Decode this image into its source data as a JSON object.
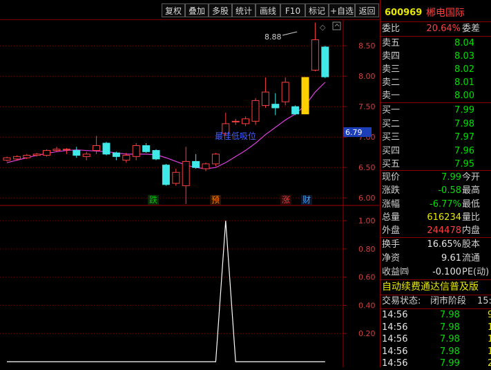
{
  "toolbar": {
    "buttons": [
      "复权",
      "叠加",
      "多股",
      "统计",
      "画线",
      "F10",
      "标记",
      "+自选",
      "返回"
    ]
  },
  "stock": {
    "code": "600969",
    "name": "郴电国际"
  },
  "orderbook": {
    "webi_label": "委比",
    "webi_value": "20.64%",
    "weicha_label": "委差",
    "asks": [
      {
        "label": "卖五",
        "price": "8.04"
      },
      {
        "label": "卖四",
        "price": "8.03"
      },
      {
        "label": "卖三",
        "price": "8.02"
      },
      {
        "label": "卖二",
        "price": "8.01"
      },
      {
        "label": "卖一",
        "price": "8.00"
      }
    ],
    "bids": [
      {
        "label": "买一",
        "price": "7.99"
      },
      {
        "label": "买二",
        "price": "7.98"
      },
      {
        "label": "买三",
        "price": "7.97"
      },
      {
        "label": "买四",
        "price": "7.96"
      },
      {
        "label": "买五",
        "price": "7.95"
      }
    ]
  },
  "quote": {
    "rows": [
      {
        "label": "现价",
        "value": "7.99",
        "label2": "今开"
      },
      {
        "label": "涨跌",
        "value": "-0.58",
        "label2": "最高"
      },
      {
        "label": "涨幅",
        "value": "-6.77%",
        "label2": "最低"
      },
      {
        "label": "总量",
        "value": "616234",
        "label2": "量比"
      },
      {
        "label": "外盘",
        "value": "244478",
        "label2": "内盘"
      }
    ],
    "rows2": [
      {
        "label": "换手",
        "value": "16.65%",
        "label2": "股本"
      },
      {
        "label": "净资",
        "value": "9.61",
        "label2": "流通"
      },
      {
        "label": "收益㈣",
        "value": "-0.100",
        "label2": "PE(动)"
      }
    ]
  },
  "news_ticker": "自动续费通达信普及版",
  "trade_status": {
    "label": "交易状态:",
    "value": "闭市阶段",
    "time": "15:"
  },
  "ticks": [
    {
      "time": "14:56",
      "price": "7.98",
      "vol": "9"
    },
    {
      "time": "14:56",
      "price": "7.98",
      "vol": "1"
    },
    {
      "time": "14:56",
      "price": "7.98",
      "vol": "1"
    },
    {
      "time": "14:56",
      "price": "7.98",
      "vol": "1"
    },
    {
      "time": "14:56",
      "price": "7.99",
      "vol": "2"
    }
  ],
  "main_chart": {
    "y_ticks": [
      "8.50",
      "8.00",
      "7.50",
      "7.00",
      "6.50",
      "6.00"
    ],
    "y_values": [
      8.5,
      8.0,
      7.5,
      7.0,
      6.5,
      6.0
    ],
    "current_price_tag": "6.79",
    "high_label": "8.88",
    "annotation": "最佳低吸位",
    "signals": [
      {
        "text": "跌",
        "color": "#00c000"
      },
      {
        "text": "预",
        "color": "#ff8000"
      },
      {
        "text": "涨",
        "color": "#ff3030"
      },
      {
        "text": "财",
        "color": "#3fa0ff"
      }
    ]
  },
  "indicator_chart": {
    "y_ticks": [
      "1.00",
      "0.80",
      "0.60",
      "0.40",
      "0.20"
    ]
  },
  "chart_data": {
    "type": "candlestick",
    "ylim": [
      5.9,
      8.9
    ],
    "candles": [
      {
        "o": 6.62,
        "c": 6.66,
        "h": 6.68,
        "l": 6.6
      },
      {
        "o": 6.64,
        "c": 6.68,
        "h": 6.7,
        "l": 6.62
      },
      {
        "o": 6.66,
        "c": 6.7,
        "h": 6.72,
        "l": 6.64
      },
      {
        "o": 6.7,
        "c": 6.72,
        "h": 6.74,
        "l": 6.68
      },
      {
        "o": 6.7,
        "c": 6.78,
        "h": 6.8,
        "l": 6.68
      },
      {
        "o": 6.78,
        "c": 6.8,
        "h": 6.84,
        "l": 6.76
      },
      {
        "o": 6.8,
        "c": 6.8,
        "h": 6.82,
        "l": 6.72
      },
      {
        "o": 6.78,
        "c": 6.7,
        "h": 6.84,
        "l": 6.66
      },
      {
        "o": 6.68,
        "c": 6.72,
        "h": 6.76,
        "l": 6.62
      },
      {
        "o": 6.78,
        "c": 6.86,
        "h": 7.02,
        "l": 6.72
      },
      {
        "o": 6.9,
        "c": 6.72,
        "h": 6.92,
        "l": 6.7
      },
      {
        "o": 6.74,
        "c": 6.68,
        "h": 6.76,
        "l": 6.62
      },
      {
        "o": 6.62,
        "c": 6.7,
        "h": 6.74,
        "l": 6.58
      },
      {
        "o": 6.68,
        "c": 6.86,
        "h": 6.9,
        "l": 6.62
      },
      {
        "o": 6.86,
        "c": 6.76,
        "h": 6.9,
        "l": 6.74
      },
      {
        "o": 6.78,
        "c": 6.64,
        "h": 6.8,
        "l": 6.62
      },
      {
        "o": 6.54,
        "c": 6.22,
        "h": 6.56,
        "l": 6.2
      },
      {
        "o": 6.24,
        "c": 6.42,
        "h": 6.48,
        "l": 6.2
      },
      {
        "o": 6.2,
        "c": 6.6,
        "h": 6.84,
        "l": 5.9
      },
      {
        "o": 6.6,
        "c": 6.5,
        "h": 6.72,
        "l": 6.48
      },
      {
        "o": 6.48,
        "c": 6.56,
        "h": 6.58,
        "l": 6.44
      },
      {
        "o": 6.56,
        "c": 6.72,
        "h": 6.74,
        "l": 6.52
      },
      {
        "o": 7.06,
        "c": 7.22,
        "h": 7.4,
        "l": 7.02
      },
      {
        "o": 7.26,
        "c": 7.26,
        "h": 7.3,
        "l": 7.2
      },
      {
        "o": 7.22,
        "c": 7.3,
        "h": 7.34,
        "l": 7.18
      },
      {
        "o": 7.26,
        "c": 7.6,
        "h": 7.64,
        "l": 7.2
      },
      {
        "o": 7.52,
        "c": 7.74,
        "h": 7.98,
        "l": 7.48
      },
      {
        "o": 7.54,
        "c": 7.48,
        "h": 7.72,
        "l": 7.36
      },
      {
        "o": 7.58,
        "c": 7.9,
        "h": 7.98,
        "l": 7.52
      },
      {
        "o": 7.5,
        "c": 7.38,
        "h": 7.52,
        "l": 7.36
      },
      {
        "o": 7.38,
        "c": 7.98,
        "h": 7.98,
        "l": 7.38
      },
      {
        "o": 8.1,
        "c": 8.6,
        "h": 8.88,
        "l": 8.08
      },
      {
        "o": 8.48,
        "c": 7.99,
        "h": 8.5,
        "l": 7.97
      }
    ],
    "ma": [
      6.58,
      6.62,
      6.66,
      6.7,
      6.73,
      6.76,
      6.78,
      6.79,
      6.78,
      6.77,
      6.76,
      6.74,
      6.72,
      6.72,
      6.72,
      6.71,
      6.66,
      6.6,
      6.54,
      6.5,
      6.48,
      6.5,
      6.58,
      6.68,
      6.78,
      6.9,
      7.04,
      7.16,
      7.28,
      7.38,
      7.52,
      7.74,
      7.9
    ],
    "indicator": {
      "ylim": [
        0,
        1.05
      ],
      "values": [
        0,
        0,
        0,
        0,
        0,
        0,
        0,
        0,
        0,
        0,
        0,
        0,
        0,
        0,
        0,
        0,
        0,
        0,
        0,
        0,
        0,
        0,
        1,
        0,
        0,
        0,
        0,
        0,
        0,
        0,
        0,
        0,
        0
      ]
    }
  }
}
